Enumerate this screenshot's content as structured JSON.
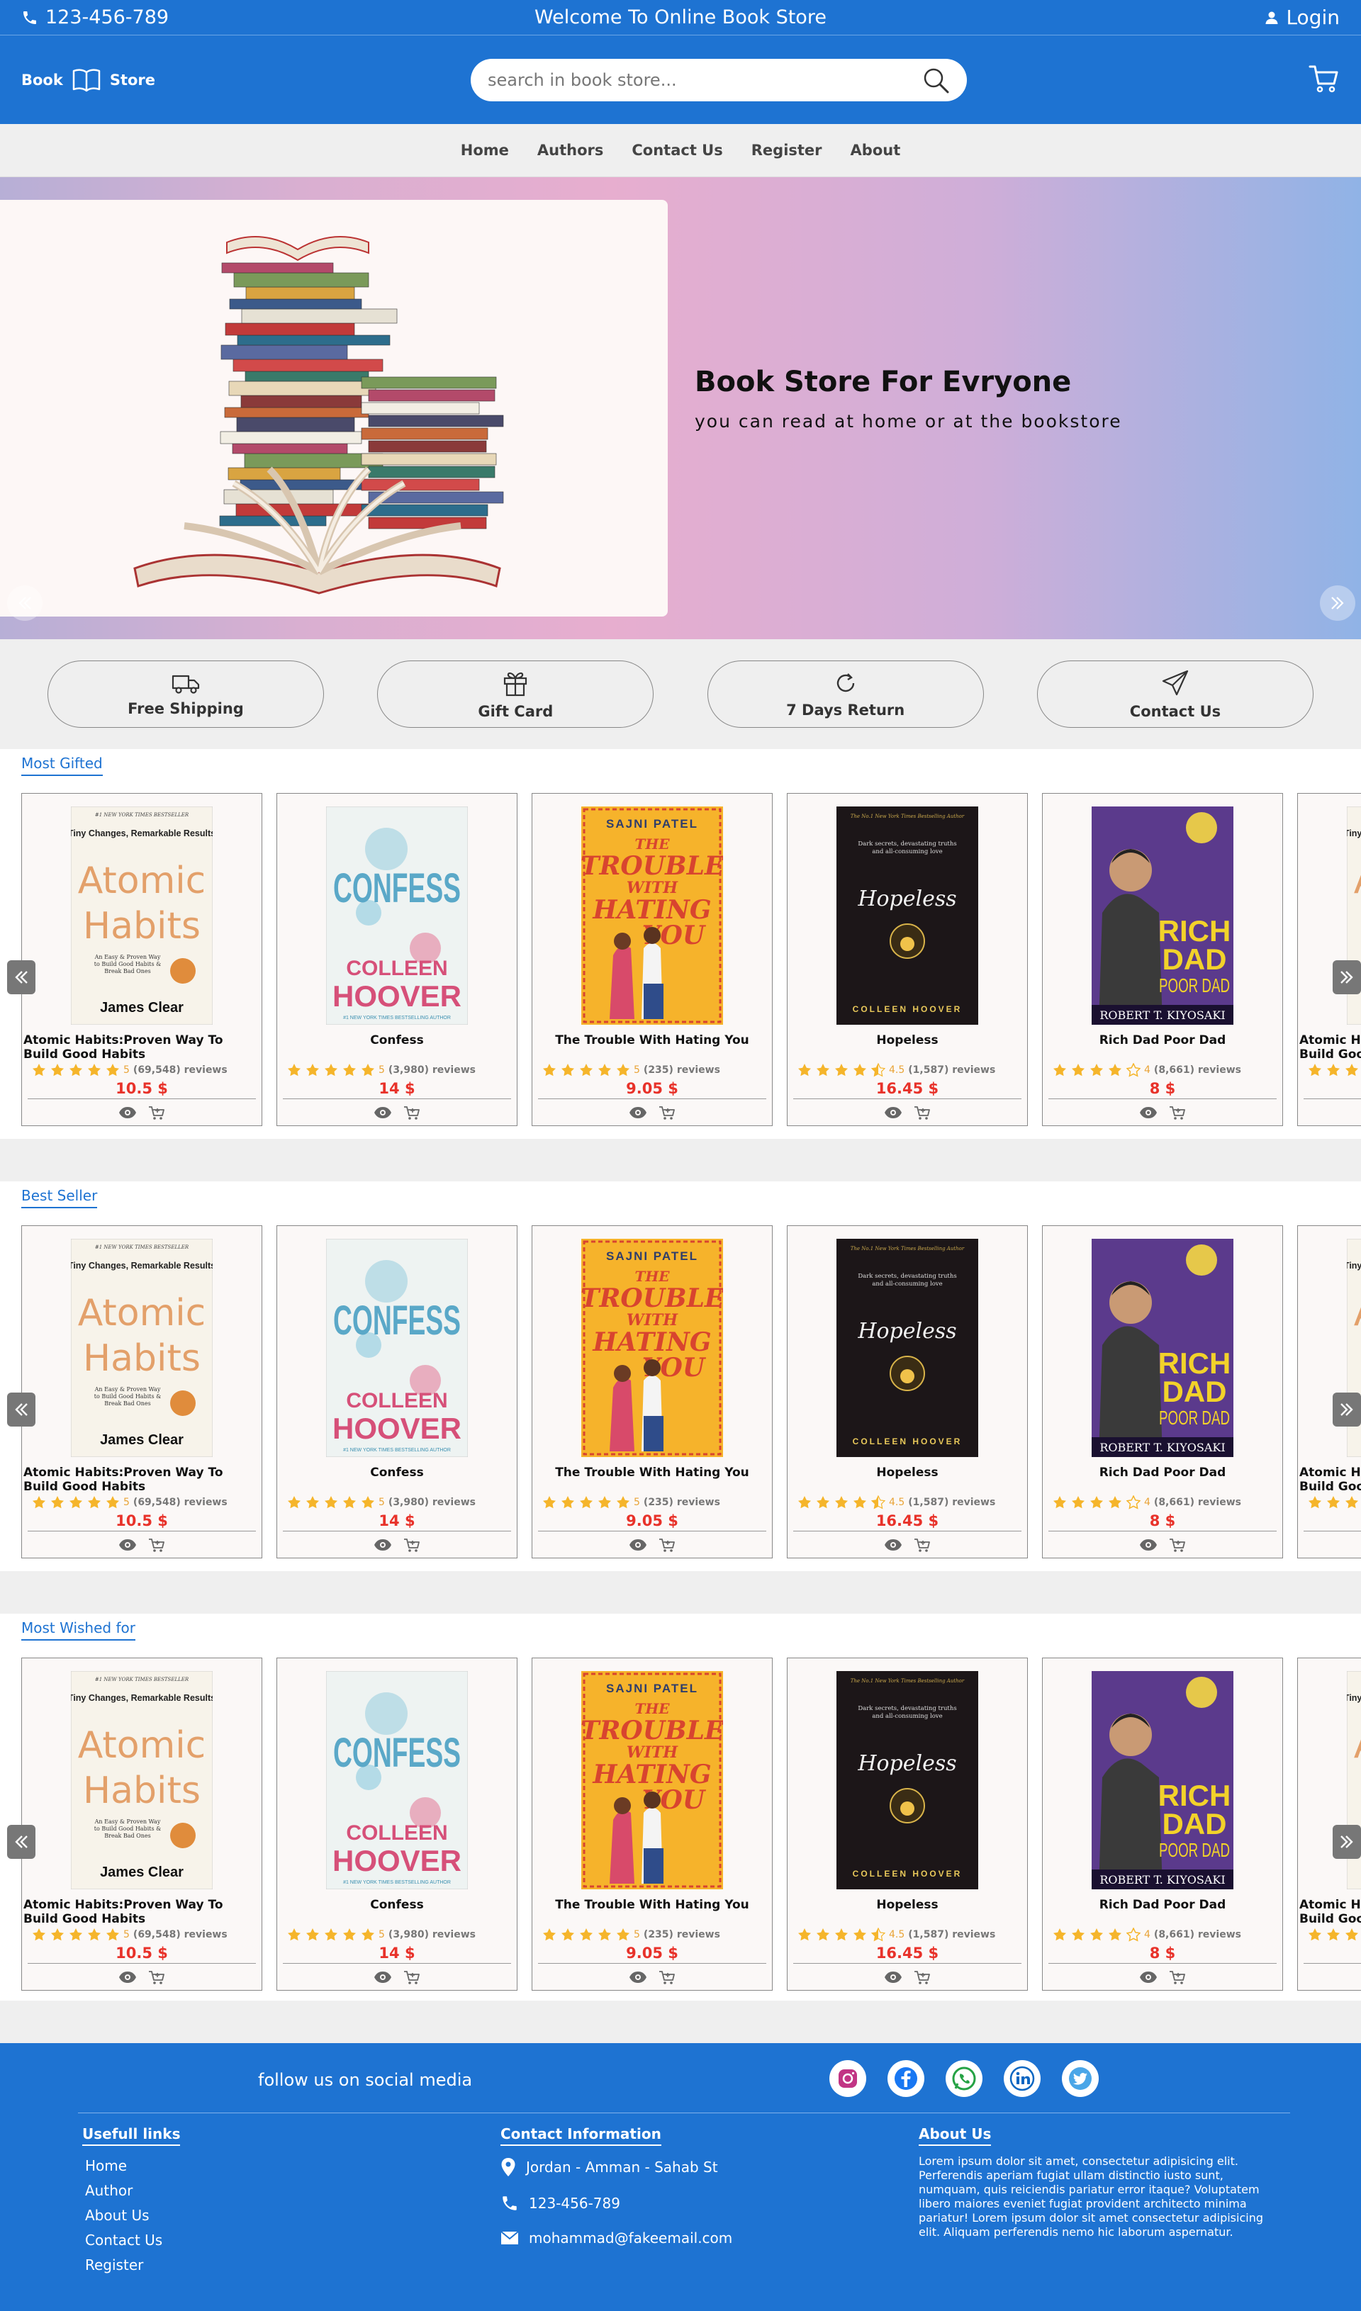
{
  "topbar": {
    "phone": "123-456-789",
    "welcome": "Welcome To Online Book Store",
    "login": "Login"
  },
  "header": {
    "logo_left": "Book",
    "logo_right": "Store",
    "search_placeholder": "search in book store..."
  },
  "nav": [
    "Home",
    "Authors",
    "Contact Us",
    "Register",
    "About"
  ],
  "hero": {
    "title": "Book Store For Evryone",
    "subtitle": "you can read at home or at the bookstore"
  },
  "features": [
    "Free Shipping",
    "Gift Card",
    "7 Days Return",
    "Contact Us"
  ],
  "sections": [
    "Most Gifted",
    "Best Seller",
    "Most Wished for"
  ],
  "books": [
    {
      "title": "Atomic Habits:Proven Way To Build Good Habits",
      "rating": "5",
      "reviews": "(69,548) reviews",
      "price": "10.5 $"
    },
    {
      "title": "Confess",
      "rating": "5",
      "reviews": "(3,980) reviews",
      "price": "14 $"
    },
    {
      "title": "The Trouble With Hating You",
      "rating": "5",
      "reviews": "(235) reviews",
      "price": "9.05 $"
    },
    {
      "title": "Hopeless",
      "rating": "4.5",
      "reviews": "(1,587) reviews",
      "price": "16.45 $"
    },
    {
      "title": "Rich Dad Poor Dad",
      "rating": "4",
      "reviews": "(8,661) reviews",
      "price": "8 $"
    }
  ],
  "covers": {
    "atomic": {
      "top": "#1 NEW YORK TIMES BESTSELLER",
      "sub": "Tiny Changes, Remarkable Results",
      "l1": "Atomic",
      "l2": "Habits",
      "tag": "An Easy & Proven Way to Build Good Habits & Break Bad Ones",
      "author": "James Clear"
    },
    "confess": {
      "l1": "CONFESS",
      "a1": "COLLEEN",
      "a2": "HOOVER",
      "tag": "#1 NEW YORK TIMES BESTSELLING AUTHOR"
    },
    "trouble": {
      "author": "SAJNI PATEL",
      "l1": "THE",
      "l2": "TROUBLE",
      "l3": "WITH",
      "l4": "HATING",
      "l5": "YOU"
    },
    "hopeless": {
      "top": "The No.1 New York Times Bestselling Author",
      "tag": "Dark secrets, devastating truths and all-consuming love",
      "l1": "Hopeless",
      "author": "COLLEEN HOOVER"
    },
    "richdad": {
      "l1": "RICH",
      "l2": "DAD",
      "l3": "POOR DAD",
      "author": "ROBERT T. KIYOSAKI"
    }
  },
  "footer": {
    "follow": "follow us on social media",
    "useful_title": "Usefull links",
    "useful": [
      "Home",
      "Author",
      "About Us",
      "Contact Us",
      "Register"
    ],
    "contact_title": "Contact Information",
    "address": "Jordan - Amman - Sahab St",
    "phone": "123-456-789",
    "email": "mohammad@fakeemail.com",
    "about_title": "About Us",
    "about_text": "Lorem ipsum dolor sit amet, consectetur adipisicing elit. Perferendis aperiam fugiat ullam distinctio iusto sunt, numquam, quis reiciendis pariatur error itaque? Voluptatem libero maiores eveniet fugiat provident architecto minima pariatur! Lorem ipsum dolor sit amet consectetur adipisicing elit. Aliquam perferendis nemo hic laborum aspernatur."
  }
}
